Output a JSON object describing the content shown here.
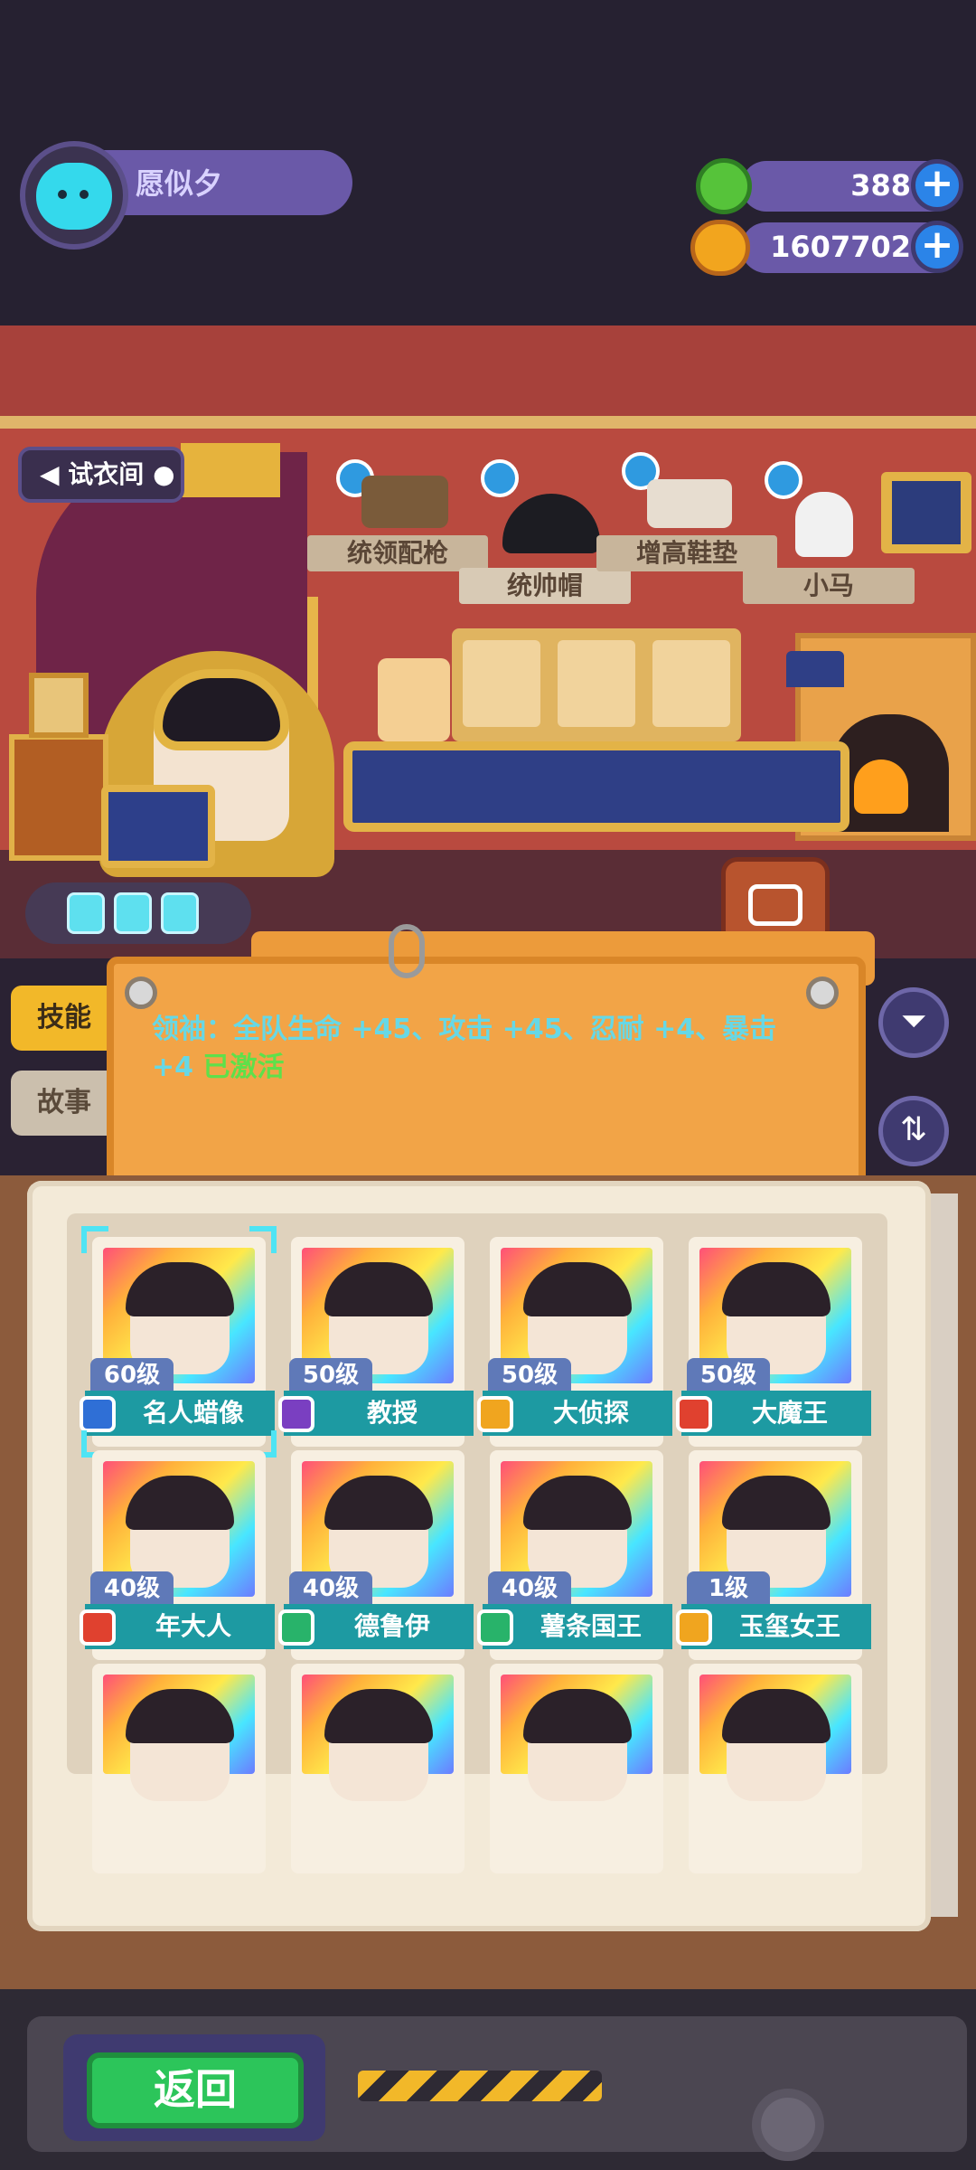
{
  "player": {
    "name": "愿似夕"
  },
  "currencies": {
    "gems": {
      "value": "388",
      "icon": "green-gem-icon"
    },
    "coins": {
      "value": "1607702",
      "icon": "gold-coin-icon"
    }
  },
  "room": {
    "tag_label": "试衣间"
  },
  "items": [
    {
      "label": "统领配枪",
      "icon": "pistol-icon"
    },
    {
      "label": "统帅帽",
      "icon": "bicorne-hat-icon"
    },
    {
      "label": "增高鞋垫",
      "icon": "insole-icon"
    },
    {
      "label": "小马",
      "icon": "horse-icon"
    }
  ],
  "tabs": {
    "skill": "技能",
    "story": "故事"
  },
  "board": {
    "text": "领袖：全队生命 +45、攻击 +45、忍耐 +4、暴击 +4",
    "active_label": "已激活"
  },
  "side_buttons": {
    "filter_icon": "filter-icon",
    "sort_icon": "sort-icon"
  },
  "characters": [
    {
      "level": "60级",
      "name": "名人蜡像",
      "class_color": "#2f6fd6",
      "selected": true
    },
    {
      "level": "50级",
      "name": "教授",
      "class_color": "#7a3fc1",
      "selected": false
    },
    {
      "level": "50级",
      "name": "大侦探",
      "class_color": "#f0a51f",
      "selected": false
    },
    {
      "level": "50级",
      "name": "大魔王",
      "class_color": "#e0412f",
      "selected": false
    },
    {
      "level": "40级",
      "name": "年大人",
      "class_color": "#e0412f",
      "selected": false
    },
    {
      "level": "40级",
      "name": "德鲁伊",
      "class_color": "#28b36a",
      "selected": false
    },
    {
      "level": "40级",
      "name": "薯条国王",
      "class_color": "#28b36a",
      "selected": false
    },
    {
      "level": "1级",
      "name": "玉玺女王",
      "class_color": "#f0a51f",
      "selected": false
    }
  ],
  "back_button": {
    "label": "返回"
  },
  "colors": {
    "accent": "#6a59a8",
    "board": "#f2a447",
    "name_bar": "#1d9aa2",
    "back_button": "#2cc55a"
  }
}
